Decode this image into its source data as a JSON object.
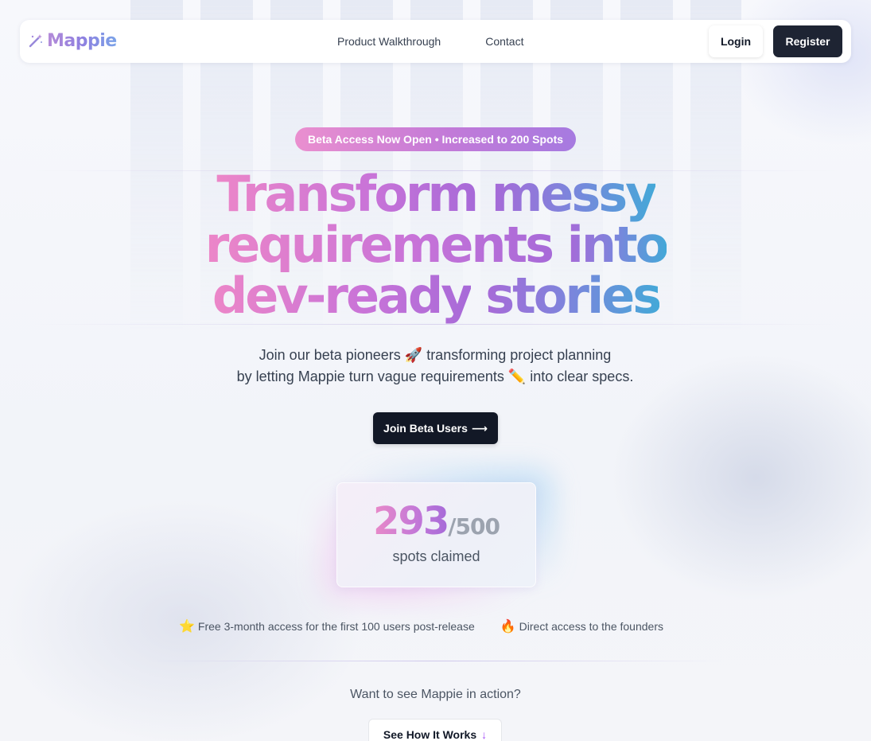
{
  "nav": {
    "logo_text": "Mappie",
    "logo_icon": "magic-wand-icon",
    "links": [
      "Product Walkthrough",
      "Contact"
    ],
    "login_label": "Login",
    "register_label": "Register"
  },
  "hero": {
    "badge": "Beta Access Now Open • Increased to 200 Spots",
    "headline": {
      "line1_a": "Transform",
      "line1_b": "messy",
      "line2_a": "requirements",
      "line2_b": "into",
      "line3_a": "dev-ready",
      "line3_b": "stories"
    },
    "subtitle_line1": "Join our beta pioneers 🚀 transforming project planning",
    "subtitle_line2": "by letting Mappie turn vague requirements ✏️ into clear specs.",
    "cta_label": "Join Beta Users",
    "cta_arrow": "⟶"
  },
  "counter": {
    "claimed": "293",
    "total": "/500",
    "label": "spots claimed"
  },
  "perks": [
    {
      "emoji": "⭐",
      "text": "Free 3-month access for the first 100 users post-release"
    },
    {
      "emoji": "🔥",
      "text": "Direct access to the founders"
    }
  ],
  "demo": {
    "prompt": "Want to see Mappie in action?",
    "button_label": "See How It Works",
    "button_arrow": "↓"
  },
  "colors": {
    "accent_pink": "#ec86c8",
    "accent_purple": "#a86ad8",
    "accent_blue": "#44a8d8",
    "dark_button": "#121826"
  }
}
